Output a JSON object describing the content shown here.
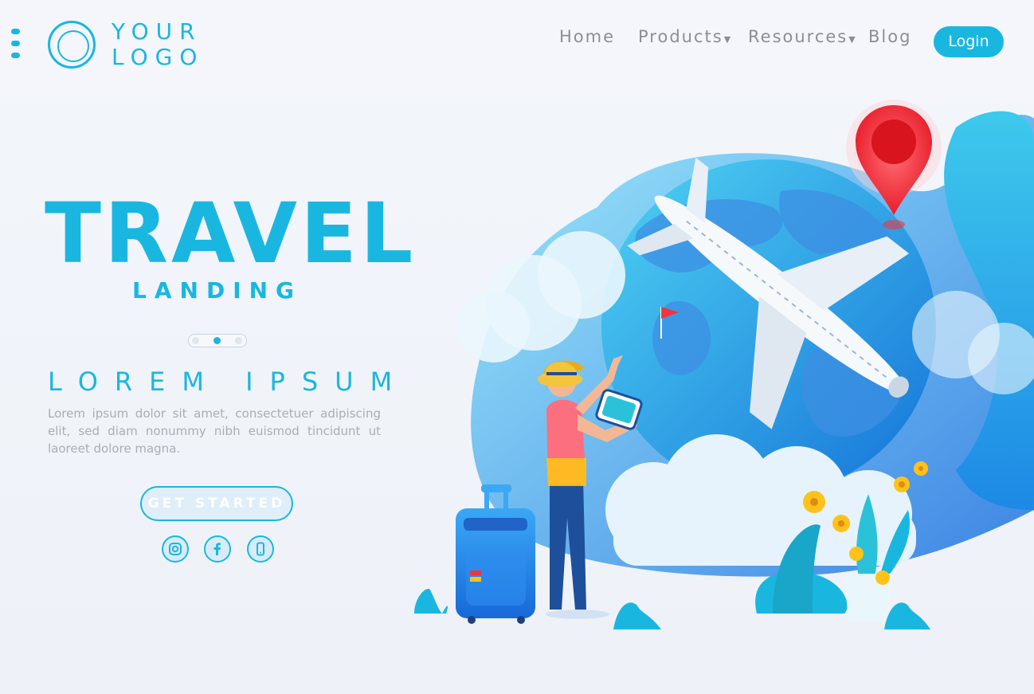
{
  "header": {
    "logo": {
      "line1": "YOUR",
      "line2": "LOGO"
    },
    "nav": [
      {
        "label": "Home",
        "has_dropdown": false
      },
      {
        "label": "Products",
        "has_dropdown": true
      },
      {
        "label": "Resources",
        "has_dropdown": true
      },
      {
        "label": "Blog",
        "has_dropdown": false
      }
    ],
    "login_label": "Login"
  },
  "hero": {
    "title": "TRAVEL",
    "subtitle": "LANDING",
    "carousel": {
      "count": 3,
      "active_index": 1
    },
    "heading": "LOREM IPSUM",
    "body": "Lorem ipsum dolor sit amet, consectetuer adipiscing elit, sed diam nonummy nibh euismod tincidunt ut laoreet dolore magna.",
    "cta_label": "GET STARTED",
    "social": [
      "instagram-icon",
      "facebook-icon",
      "phone-icon"
    ]
  },
  "colors": {
    "accent": "#19b7e0",
    "nav_text": "#8a8f96",
    "body_text": "#a9aeb5",
    "pin": "#f0353f"
  }
}
